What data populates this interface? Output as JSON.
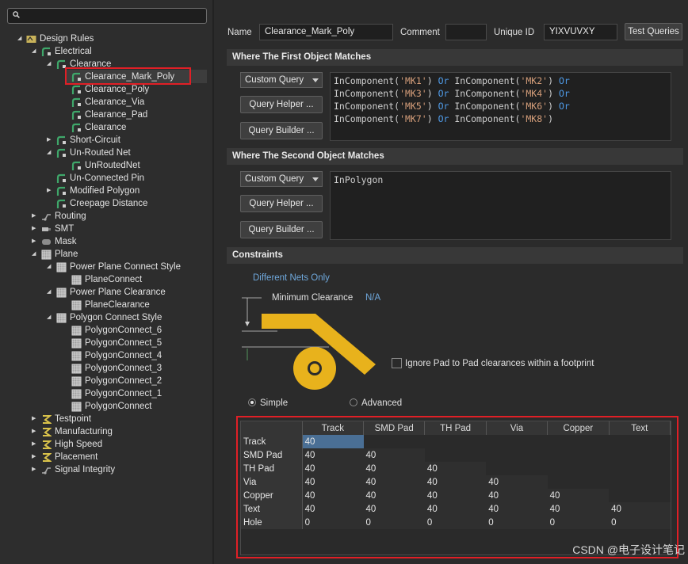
{
  "tree": {
    "search_value": "",
    "rows": [
      {
        "label": "Design Rules",
        "icon": "design-rules-icon",
        "level": 0,
        "expanded": true
      },
      {
        "label": "Electrical",
        "icon": "rule-category-icon",
        "level": 1,
        "expanded": true
      },
      {
        "label": "Clearance",
        "icon": "rule-icon",
        "level": 2,
        "expanded": true
      },
      {
        "label": "Clearance_Mark_Poly",
        "icon": "rule-icon",
        "level": 3,
        "selected": true
      },
      {
        "label": "Clearance_Poly",
        "icon": "rule-icon",
        "level": 3
      },
      {
        "label": "Clearance_Via",
        "icon": "rule-icon",
        "level": 3
      },
      {
        "label": "Clearance_Pad",
        "icon": "rule-icon",
        "level": 3
      },
      {
        "label": "Clearance",
        "icon": "rule-icon",
        "level": 3
      },
      {
        "label": "Short-Circuit",
        "icon": "rule-icon",
        "level": 2,
        "collapsed": true
      },
      {
        "label": "Un-Routed Net",
        "icon": "rule-icon",
        "level": 2,
        "expanded": true
      },
      {
        "label": "UnRoutedNet",
        "icon": "rule-icon",
        "level": 3
      },
      {
        "label": "Un-Connected Pin",
        "icon": "rule-icon",
        "level": 2
      },
      {
        "label": "Modified Polygon",
        "icon": "rule-icon",
        "level": 2,
        "collapsed": true
      },
      {
        "label": "Creepage Distance",
        "icon": "rule-icon",
        "level": 2
      },
      {
        "label": "Routing",
        "icon": "routing-icon",
        "level": 1,
        "collapsed": true
      },
      {
        "label": "SMT",
        "icon": "smt-icon",
        "level": 1,
        "collapsed": true
      },
      {
        "label": "Mask",
        "icon": "mask-icon",
        "level": 1,
        "collapsed": true
      },
      {
        "label": "Plane",
        "icon": "plane-icon",
        "level": 1,
        "expanded": true
      },
      {
        "label": "Power Plane Connect Style",
        "icon": "plane-icon",
        "level": 2,
        "expanded": true
      },
      {
        "label": "PlaneConnect",
        "icon": "plane-icon",
        "level": 3
      },
      {
        "label": "Power Plane Clearance",
        "icon": "plane-icon",
        "level": 2,
        "expanded": true
      },
      {
        "label": "PlaneClearance",
        "icon": "plane-icon",
        "level": 3
      },
      {
        "label": "Polygon Connect Style",
        "icon": "plane-icon",
        "level": 2,
        "expanded": true
      },
      {
        "label": "PolygonConnect_6",
        "icon": "plane-icon",
        "level": 3
      },
      {
        "label": "PolygonConnect_5",
        "icon": "plane-icon",
        "level": 3
      },
      {
        "label": "PolygonConnect_4",
        "icon": "plane-icon",
        "level": 3
      },
      {
        "label": "PolygonConnect_3",
        "icon": "plane-icon",
        "level": 3
      },
      {
        "label": "PolygonConnect_2",
        "icon": "plane-icon",
        "level": 3
      },
      {
        "label": "PolygonConnect_1",
        "icon": "plane-icon",
        "level": 3
      },
      {
        "label": "PolygonConnect",
        "icon": "plane-icon",
        "level": 3
      },
      {
        "label": "Testpoint",
        "icon": "testpoint-icon",
        "level": 1,
        "collapsed": true
      },
      {
        "label": "Manufacturing",
        "icon": "manufacturing-icon",
        "level": 1,
        "collapsed": true
      },
      {
        "label": "High Speed",
        "icon": "high-speed-icon",
        "level": 1,
        "collapsed": true
      },
      {
        "label": "Placement",
        "icon": "placement-icon",
        "level": 1,
        "collapsed": true
      },
      {
        "label": "Signal Integrity",
        "icon": "signal-integrity-icon",
        "level": 1,
        "collapsed": true
      }
    ]
  },
  "header": {
    "name_label": "Name",
    "name_value": "Clearance_Mark_Poly",
    "comment_label": "Comment",
    "comment_value": "",
    "uid_label": "Unique ID",
    "uid_value": "YIXVUVXY",
    "test_queries_label": "Test Queries"
  },
  "first_match": {
    "title": "Where The First Object Matches",
    "combo": "Custom Query",
    "helper": "Query Helper ...",
    "builder": "Query Builder ...",
    "query_lines": [
      [
        {
          "t": "InComponent("
        },
        {
          "s": "'MK1'"
        },
        {
          "t": ") "
        },
        {
          "k": "Or"
        },
        {
          "t": " InComponent("
        },
        {
          "s": "'MK2'"
        },
        {
          "t": ") "
        },
        {
          "k": "Or"
        }
      ],
      [
        {
          "t": "InComponent("
        },
        {
          "s": "'MK3'"
        },
        {
          "t": ") "
        },
        {
          "k": "Or"
        },
        {
          "t": " InComponent("
        },
        {
          "s": "'MK4'"
        },
        {
          "t": ") "
        },
        {
          "k": "Or"
        }
      ],
      [
        {
          "t": "InComponent("
        },
        {
          "s": "'MK5'"
        },
        {
          "t": ") "
        },
        {
          "k": "Or"
        },
        {
          "t": " InComponent("
        },
        {
          "s": "'MK6'"
        },
        {
          "t": ") "
        },
        {
          "k": "Or"
        }
      ],
      [
        {
          "t": "InComponent("
        },
        {
          "s": "'MK7'"
        },
        {
          "t": ") "
        },
        {
          "k": "Or"
        },
        {
          "t": " InComponent("
        },
        {
          "s": "'MK8'"
        },
        {
          "t": ")"
        }
      ]
    ]
  },
  "second_match": {
    "title": "Where The Second Object Matches",
    "combo": "Custom Query",
    "helper": "Query Helper ...",
    "builder": "Query Builder ...",
    "query": "InPolygon"
  },
  "constraints": {
    "title": "Constraints",
    "net_scope": "Different Nets Only",
    "min_clearance_label": "Minimum Clearance",
    "min_clearance_value": "N/A",
    "ignore_pad_label": "Ignore Pad to Pad clearances within a footprint",
    "ignore_pad_checked": false,
    "mode_simple": "Simple",
    "mode_advanced": "Advanced",
    "mode_selected": "Simple",
    "accent_color": "#e8b21c",
    "link_color": "#6fa8dc"
  },
  "matrix": {
    "columns": [
      "Track",
      "SMD Pad",
      "TH Pad",
      "Via",
      "Copper",
      "Text"
    ],
    "rows": [
      {
        "name": "Track",
        "values": [
          "40",
          "",
          "",
          "",
          "",
          ""
        ]
      },
      {
        "name": "SMD Pad",
        "values": [
          "40",
          "40",
          "",
          "",
          "",
          ""
        ]
      },
      {
        "name": "TH Pad",
        "values": [
          "40",
          "40",
          "40",
          "",
          "",
          ""
        ]
      },
      {
        "name": "Via",
        "values": [
          "40",
          "40",
          "40",
          "40",
          "",
          ""
        ]
      },
      {
        "name": "Copper",
        "values": [
          "40",
          "40",
          "40",
          "40",
          "40",
          ""
        ]
      },
      {
        "name": "Text",
        "values": [
          "40",
          "40",
          "40",
          "40",
          "40",
          "40"
        ]
      },
      {
        "name": "Hole",
        "values": [
          "0",
          "0",
          "0",
          "0",
          "0",
          "0"
        ]
      }
    ]
  },
  "watermark": "CSDN @电子设计笔记"
}
